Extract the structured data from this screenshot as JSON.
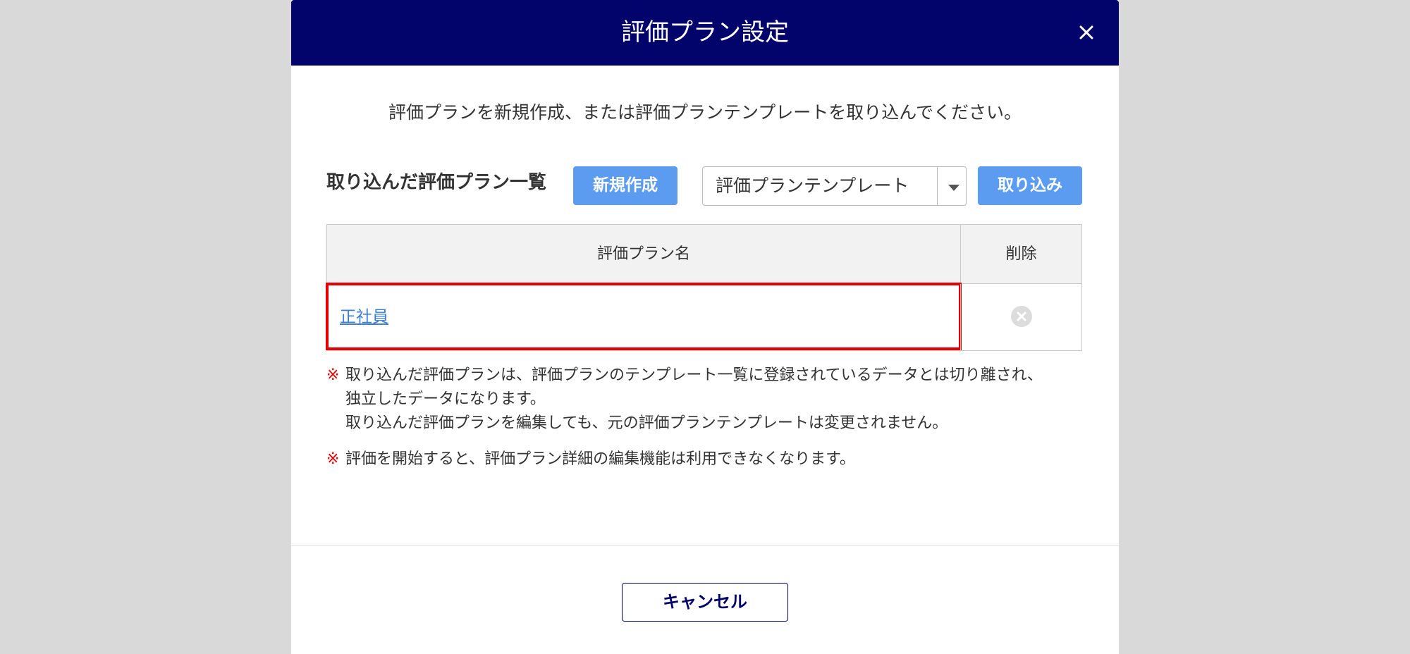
{
  "dialog": {
    "title": "評価プラン設定",
    "close_icon": "close-icon",
    "intro": "評価プランを新規作成、または評価プランテンプレートを取り込んでください。"
  },
  "toolbar": {
    "section_title": "取り込んだ評価プラン一覧",
    "new_button": "新規作成",
    "template_select_value": "評価プランテンプレート",
    "import_button": "取り込み"
  },
  "table": {
    "headers": {
      "name": "評価プラン名",
      "delete": "削除"
    },
    "rows": [
      {
        "name": "正社員",
        "delete_icon": "circle-x-icon"
      }
    ]
  },
  "notes": [
    {
      "mark": "※",
      "lines": [
        "取り込んだ評価プランは、評価プランのテンプレート一覧に登録されているデータとは切り離され、",
        "独立したデータになります。",
        "取り込んだ評価プランを編集しても、元の評価プランテンプレートは変更されません。"
      ]
    },
    {
      "mark": "※",
      "lines": [
        "評価を開始すると、評価プラン詳細の編集機能は利用できなくなります。"
      ]
    }
  ],
  "footer": {
    "cancel_button": "キャンセル"
  },
  "colors": {
    "header_bg": "#02036b",
    "primary_button": "#5b9bf0",
    "link": "#3b7dd8",
    "highlight": "#e60000",
    "note_mark": "#e60000"
  }
}
